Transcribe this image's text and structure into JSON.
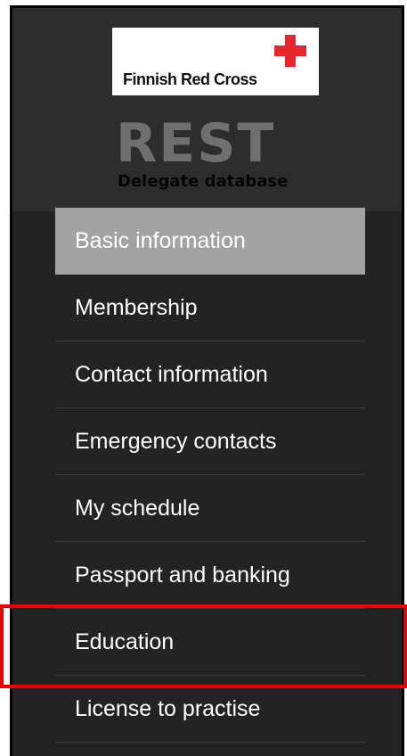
{
  "logo": {
    "text": "Finnish Red Cross",
    "cross_color": "#e8262d"
  },
  "app": {
    "title": "REST",
    "subtitle": "Delegate database"
  },
  "nav": {
    "items": [
      {
        "label": "Basic information",
        "active": true
      },
      {
        "label": "Membership",
        "active": false
      },
      {
        "label": "Contact information",
        "active": false
      },
      {
        "label": "Emergency contacts",
        "active": false
      },
      {
        "label": "My schedule",
        "active": false
      },
      {
        "label": "Passport and banking",
        "active": false
      },
      {
        "label": "Education",
        "active": false
      },
      {
        "label": "License to practise",
        "active": false
      }
    ]
  },
  "annotation": {
    "highlight_color": "#ee0000",
    "highlighted_item": "Education"
  }
}
